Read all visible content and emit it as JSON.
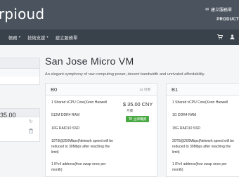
{
  "header": {
    "brand": "rpioud",
    "notice_icon": "bell-icon",
    "notice_label": "建立服務單",
    "right_label": "PRODUCT"
  },
  "nav": {
    "items": [
      {
        "label": "帳務",
        "caret": "▾"
      },
      {
        "label": "技術支援",
        "caret": "▾"
      },
      {
        "label": "建立服務單"
      }
    ],
    "right_icons": [
      "cart-icon",
      "user-icon"
    ]
  },
  "sidebar": {
    "price": "35.00",
    "icons": [
      "refresh-icon",
      "trash-icon"
    ]
  },
  "page": {
    "title": "San Jose Micro VM",
    "subtitle": "An elegant symphony of raw computing power, decent bandwidth and unrivaled affordability."
  },
  "plans": [
    {
      "name": "B0",
      "stock": "32 可用",
      "specs": [
        "1 Shared vCPU Core(Xeon Haswell",
        "512M DDR4 RAM",
        "10G RAID10 SSD",
        "10TB@200Mbps(Network speed will be reduced to 30Mbps after reaching the limit)",
        "1 IPv4 address(free swap once per month)"
      ],
      "price": "$ 35.00 CNY",
      "cycle": "月費",
      "buy_label": "立即購買"
    },
    {
      "name": "B1",
      "specs": [
        "1 Shared vCPU Core(Xeon Haswell",
        "1G DDR4 RAM",
        "15G RAID10 SSD",
        "20TB@200Mbps(Network speed will be reduced to 30Mbps after reaching the limit)",
        "1 IPv4 address(free swap once per month)"
      ]
    }
  ],
  "colors": {
    "header_bg": "#4a535e",
    "nav_bg": "#39414b",
    "buy_button": "#49a942"
  }
}
